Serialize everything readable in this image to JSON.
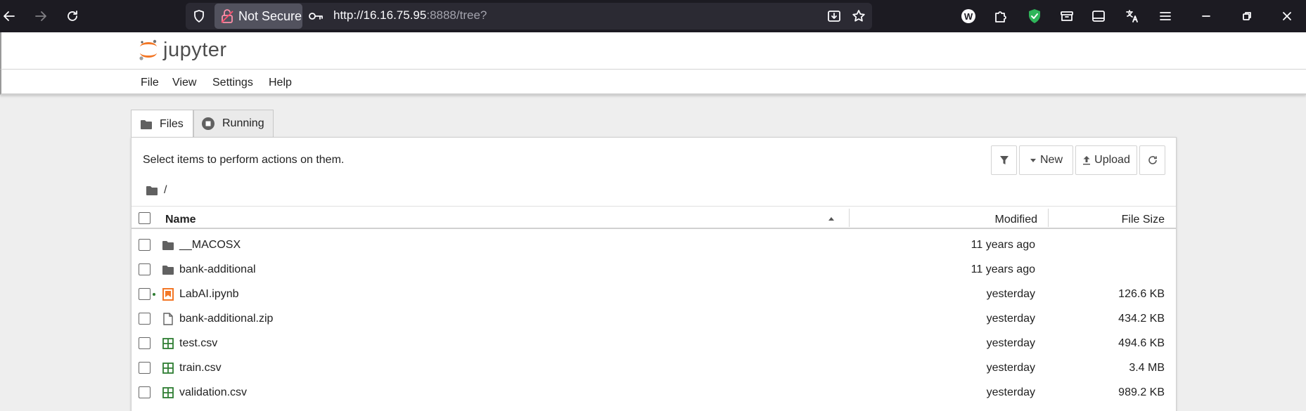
{
  "browser": {
    "security_label": "Not Secure",
    "url_host": "http://16.16.75.95",
    "url_rest": ":8888/tree?"
  },
  "app": {
    "logo_text": "jupyter",
    "menu": [
      "File",
      "View",
      "Settings",
      "Help"
    ]
  },
  "tabs": [
    {
      "label": "Files",
      "active": true
    },
    {
      "label": "Running",
      "active": false
    }
  ],
  "toolbar": {
    "hint": "Select items to perform actions on them.",
    "new_label": "New",
    "upload_label": "Upload"
  },
  "breadcrumb": "/",
  "table": {
    "headers": {
      "name": "Name",
      "modified": "Modified",
      "size": "File Size"
    },
    "rows": [
      {
        "name": "__MACOSX",
        "type": "folder",
        "modified": "11 years ago",
        "size": ""
      },
      {
        "name": "bank-additional",
        "type": "folder",
        "modified": "11 years ago",
        "size": ""
      },
      {
        "name": "LabAI.ipynb",
        "type": "notebook",
        "running": true,
        "modified": "yesterday",
        "size": "126.6 KB"
      },
      {
        "name": "bank-additional.zip",
        "type": "file",
        "modified": "yesterday",
        "size": "434.2 KB"
      },
      {
        "name": "test.csv",
        "type": "csv",
        "modified": "yesterday",
        "size": "494.6 KB"
      },
      {
        "name": "train.csv",
        "type": "csv",
        "modified": "yesterday",
        "size": "3.4 MB"
      },
      {
        "name": "validation.csv",
        "type": "csv",
        "modified": "yesterday",
        "size": "989.2 KB"
      }
    ]
  },
  "colors": {
    "chrome_bg": "#1c1b22",
    "jupyter_orange": "#f37726",
    "csv_green": "#2e7d32"
  }
}
